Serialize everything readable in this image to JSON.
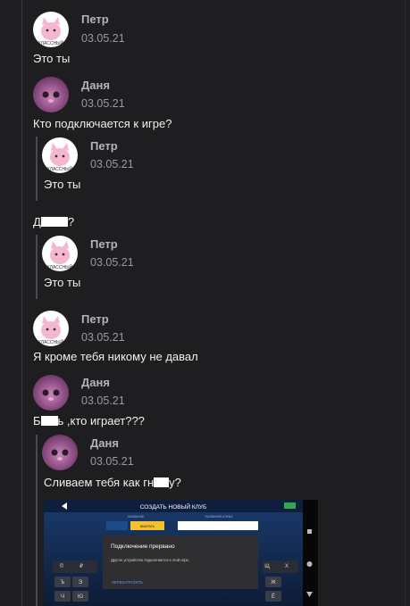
{
  "messages": [
    {
      "author": "Петр",
      "date": "03.05.21",
      "text": "Это ты",
      "avatar": "pink-cat"
    },
    {
      "author": "Даня",
      "date": "03.05.21",
      "text": "Кто подключается к игре?",
      "avatar": "purple-cat",
      "quote": {
        "author": "Петр",
        "date": "03.05.21",
        "text": "Это ты"
      }
    },
    {
      "text_prefix": "Д",
      "text_suffix": "?",
      "quote": {
        "author": "Петр",
        "date": "03.05.21",
        "text": "Это ты"
      }
    },
    {
      "author": "Петр",
      "date": "03.05.21",
      "text": "Я кроме тебя никому не давал",
      "avatar": "pink-cat"
    },
    {
      "author": "Даня",
      "date": "03.05.21",
      "text_prefix": "Б",
      "text_suffix": "ь ,кто играет???",
      "avatar": "purple-cat",
      "quote": {
        "author": "Даня",
        "date": "03.05.21",
        "text_prefix": "Сливаем тебя как гн",
        "text_suffix": "у?"
      }
    }
  ],
  "avatar_label": "КЛАССНЫЙ",
  "screenshot": {
    "header": "СОЗДАТЬ НОВЫЙ КЛУБ",
    "labels": [
      "НАЗВАНИЕ",
      "НАЗВАНИЕ КЛУБА"
    ],
    "select_btn": "ВЫБРАТЬ",
    "dialog_title": "Подключение прервано",
    "dialog_body": "Другое устройство подключается к этой игре.",
    "dialog_button": "ПЕРЕЗАГРУЗИТЬ",
    "keys": [
      "©",
      "₽",
      "Щ",
      "Х",
      "Ъ",
      "Э",
      "Ж",
      "Ч",
      "Ю",
      "Ё"
    ]
  },
  "colors": {
    "background": "#1e1e20",
    "dialog": "#2f2f31",
    "dialog_link": "#4f9cff"
  }
}
